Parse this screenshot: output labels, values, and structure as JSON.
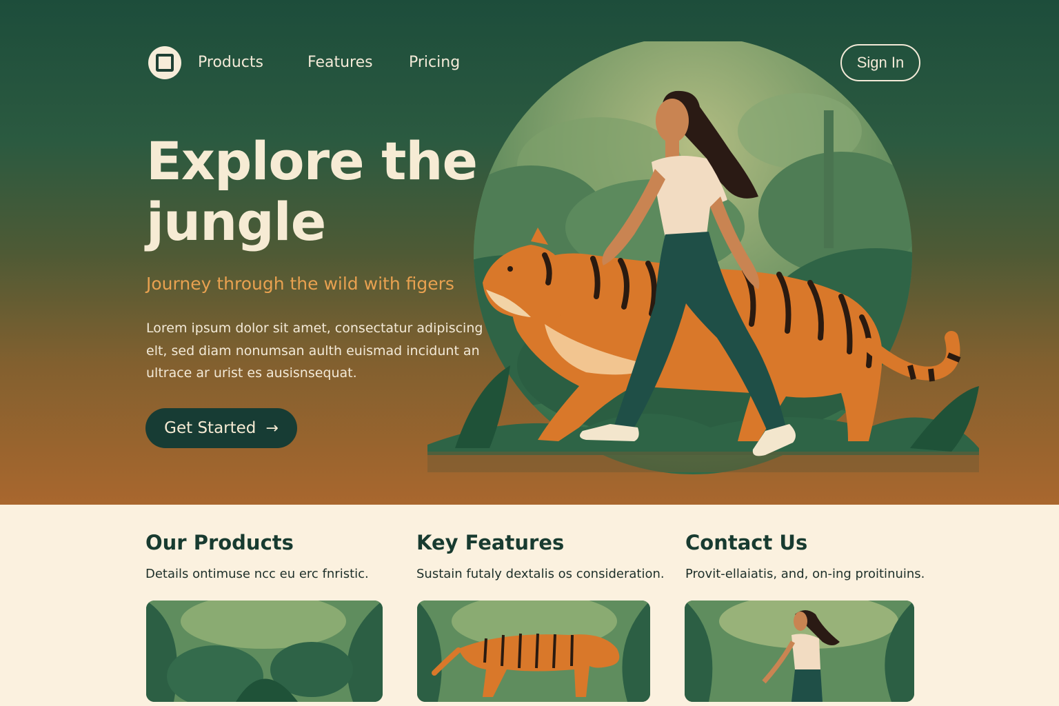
{
  "nav": {
    "logo_icon": "square-logo-icon",
    "links": [
      "Products",
      "Features",
      "Pricing"
    ],
    "sign_in": "Sign In"
  },
  "hero": {
    "title": "Explore the jungle",
    "subtitle": "Journey through the wild with figers",
    "body": "Lorem ipsum dolor sit amet, consectatur adipiscing elt, sed diam nonumsan aulth euismad incidunt an ultrace ar urist es ausisnsequat.",
    "cta_label": "Get Started",
    "cta_icon": "arrow-right-icon"
  },
  "sections": [
    {
      "title": "Our Products",
      "description": "Details ontimuse ncc eu erc fnristic."
    },
    {
      "title": "Key Features",
      "description": "Sustain futaly dextalis os consideration."
    },
    {
      "title": "Contact Us",
      "description": "Provit-ellaiatis, and, on-ing proitinuins."
    }
  ],
  "colors": {
    "hero_top": "#1d4d3b",
    "hero_bottom": "#a9672e",
    "accent_orange": "#e8a150",
    "cream": "#fbf1df",
    "dark_green": "#173c34"
  }
}
